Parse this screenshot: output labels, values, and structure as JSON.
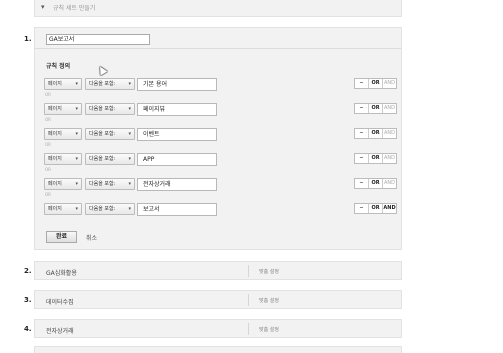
{
  "top": {
    "bullet": "▾",
    "label": "규칙 세트 만들기"
  },
  "section1": {
    "number": "1.",
    "name_value": "GA보고서",
    "rules_title": "규칙 정의",
    "rules": [
      {
        "dim": "페이지",
        "op": "다음을 포함:",
        "value": "기본 용어",
        "minus": "−",
        "or": "OR",
        "and": "AND",
        "and_active": false
      },
      {
        "dim": "페이지",
        "op": "다음을 포함:",
        "value": "페이지뷰",
        "minus": "−",
        "or": "OR",
        "and": "AND",
        "and_active": false
      },
      {
        "dim": "페이지",
        "op": "다음을 포함:",
        "value": "이벤트",
        "minus": "−",
        "or": "OR",
        "and": "AND",
        "and_active": false
      },
      {
        "dim": "페이지",
        "op": "다음을 포함:",
        "value": "APP",
        "minus": "−",
        "or": "OR",
        "and": "AND",
        "and_active": false
      },
      {
        "dim": "페이지",
        "op": "다음을 포함:",
        "value": "전자상거래",
        "minus": "−",
        "or": "OR",
        "and": "AND",
        "and_active": false
      },
      {
        "dim": "페이지",
        "op": "다음을 포함:",
        "value": "보고서",
        "minus": "−",
        "or": "OR",
        "and": "AND",
        "and_active": true
      }
    ],
    "or_label": "OR",
    "done_label": "완료",
    "cancel_label": "취소"
  },
  "sections": [
    {
      "number": "2.",
      "title": "GA심화활용",
      "setting": "맞춤 설정"
    },
    {
      "number": "3.",
      "title": "데이터수집",
      "setting": "맞춤 설정"
    },
    {
      "number": "4.",
      "title": "전자상거래",
      "setting": "맞춤 설정"
    }
  ]
}
